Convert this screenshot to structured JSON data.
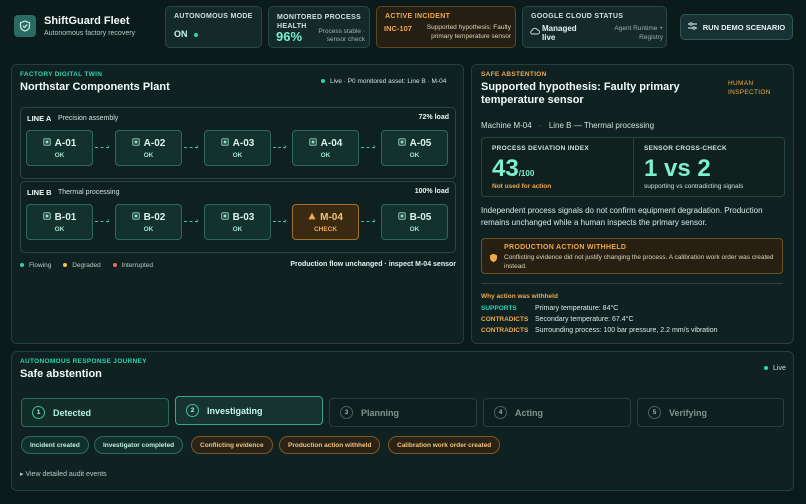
{
  "brand": {
    "title": "ShiftGuard Fleet",
    "subtitle": "Autonomous factory recovery"
  },
  "header_cards": {
    "autonomous": {
      "label": "Autonomous mode",
      "value": "ON"
    },
    "health": {
      "label": "Monitored process health",
      "value": "96%",
      "note": "Process stable · sensor check"
    },
    "incident": {
      "label": "Active incident",
      "id": "INC-107",
      "text": "Supported hypothesis: Faulty primary temperature sensor"
    },
    "cloud": {
      "label": "Google Cloud status",
      "value": "Managed live",
      "note": "Agent Runtime + Registry"
    }
  },
  "run_button": {
    "label": "Run demo scenario"
  },
  "twin": {
    "label": "Factory digital twin",
    "title": "Northstar Components Plant",
    "live": "Live · P0 monitored asset: Line B · M-04",
    "lines": [
      {
        "name": "LINE A",
        "desc": "Precision assembly",
        "load": "72% load",
        "machines": [
          {
            "name": "A-01",
            "status": "OK",
            "warn": false
          },
          {
            "name": "A-02",
            "status": "OK",
            "warn": false
          },
          {
            "name": "A-03",
            "status": "OK",
            "warn": false
          },
          {
            "name": "A-04",
            "status": "OK",
            "warn": false
          },
          {
            "name": "A-05",
            "status": "OK",
            "warn": false
          }
        ]
      },
      {
        "name": "LINE B",
        "desc": "Thermal processing",
        "load": "100% load",
        "machines": [
          {
            "name": "B-01",
            "status": "OK",
            "warn": false
          },
          {
            "name": "B-02",
            "status": "OK",
            "warn": false
          },
          {
            "name": "B-03",
            "status": "OK",
            "warn": false
          },
          {
            "name": "M-04",
            "status": "CHECK",
            "warn": true
          },
          {
            "name": "B-05",
            "status": "OK",
            "warn": false
          }
        ]
      }
    ],
    "legend": {
      "flowing": "Flowing",
      "degraded": "Degraded",
      "interrupted": "Interrupted"
    },
    "footer": "Production flow unchanged · inspect M-04 sensor"
  },
  "abstention": {
    "label": "Safe abstention",
    "title": "Supported hypothesis: Faulty primary temperature sensor",
    "badge": "Human inspection",
    "machine": "Machine M-04",
    "line": "Line B — Thermal processing",
    "deviation": {
      "label": "Process deviation index",
      "value": "43",
      "unit": "/100",
      "note": "Not used for action"
    },
    "crosscheck": {
      "label": "Sensor cross-check",
      "value": "1 vs 2",
      "note": "supporting vs contradicting signals"
    },
    "summary": "Independent process signals do not confirm equipment degradation. Production remains unchanged while a human inspects the primary sensor.",
    "withheld": {
      "title": "Production action withheld",
      "text": "Conflicting evidence did not justify changing the process. A calibration work order was created instead."
    },
    "why_label": "Why action was withheld",
    "evidence": [
      {
        "tag": "SUPPORTS",
        "text": "Primary temperature: 84°C"
      },
      {
        "tag": "CONTRADICTS",
        "text": "Secondary temperature: 67.4°C"
      },
      {
        "tag": "CONTRADICTS",
        "text": "Surrounding process: 100 bar pressure, 2.2 mm/s vibration"
      }
    ]
  },
  "journey": {
    "label": "Autonomous response journey",
    "title": "Safe abstention",
    "live": "Live",
    "steps": [
      {
        "num": "1",
        "label": "Detected"
      },
      {
        "num": "2",
        "label": "Investigating"
      },
      {
        "num": "3",
        "label": "Planning"
      },
      {
        "num": "4",
        "label": "Acting"
      },
      {
        "num": "5",
        "label": "Verifying"
      }
    ],
    "chips": [
      "Incident created",
      "Investigator completed",
      "Conflicting evidence",
      "Production action withheld",
      "Calibration work order created"
    ],
    "audit": "▸ View detailed audit events"
  },
  "colors": {
    "accent": "#2fd3b0",
    "warning": "#f0a84a",
    "background": "#0b1a1a"
  }
}
